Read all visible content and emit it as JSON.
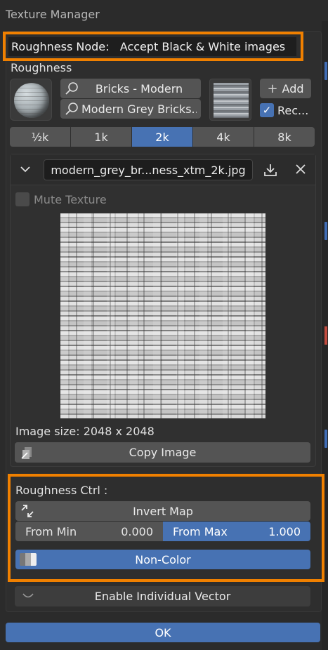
{
  "window": {
    "title": "Texture Manager"
  },
  "header": {
    "node_label": "Roughness Node:",
    "node_mode": "Accept Black & White images"
  },
  "section": {
    "label": "Roughness"
  },
  "asset": {
    "category": "Bricks - Modern",
    "name": "Modern Grey Bricks...",
    "add_label": "Add",
    "rec_label": "Rec..."
  },
  "resolutions": [
    "½k",
    "1k",
    "2k",
    "4k",
    "8k"
  ],
  "active_resolution": "2k",
  "texture": {
    "filename": "modern_grey_br...ness_xtm_2k.jpg",
    "mute_label": "Mute Texture",
    "image_size": "Image size: 2048 x 2048",
    "copy_label": "Copy Image"
  },
  "ctrl": {
    "label": "Roughness Ctrl :",
    "invert_label": "Invert Map",
    "from_min_label": "From Min",
    "from_min_value": "0.000",
    "from_max_label": "From Max",
    "from_max_value": "1.000",
    "colorspace": "Non-Color"
  },
  "vector": {
    "label": "Enable Individual Vector"
  },
  "footer": {
    "ok_label": "OK"
  },
  "colors": {
    "accent": "#4772b3",
    "highlight": "#f08000",
    "panel": "#2e2e2e"
  }
}
